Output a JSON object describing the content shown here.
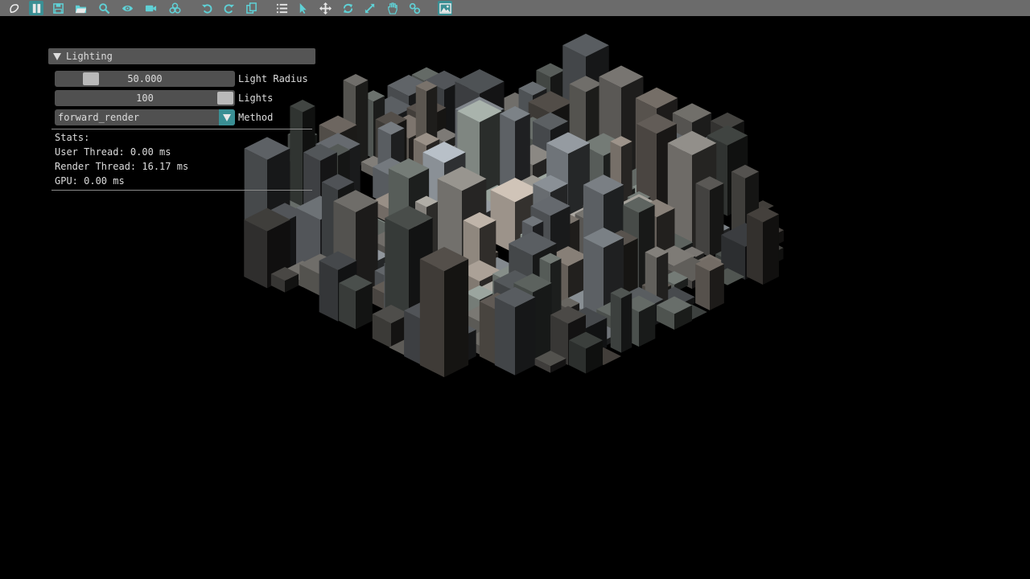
{
  "toolbar": {
    "buttons": [
      {
        "icon": "logo-icon"
      },
      {
        "icon": "pause-icon"
      },
      {
        "icon": "save-icon"
      },
      {
        "icon": "open-folder-icon"
      },
      {
        "icon": "search-icon"
      },
      {
        "icon": "eye-icon"
      },
      {
        "icon": "camera-icon"
      },
      {
        "icon": "nodes-icon"
      },
      {
        "icon": "undo-icon"
      },
      {
        "icon": "redo-icon"
      },
      {
        "icon": "copy-icon"
      },
      {
        "icon": "list-icon"
      },
      {
        "icon": "pointer-icon"
      },
      {
        "icon": "move-icon"
      },
      {
        "icon": "rotate-icon"
      },
      {
        "icon": "scale-icon"
      },
      {
        "icon": "hand-icon"
      },
      {
        "icon": "link-icon"
      },
      {
        "icon": "image-icon"
      }
    ],
    "icon_color": "#5fd1d6"
  },
  "panel": {
    "title": "Lighting",
    "light_radius": {
      "value": "50.000",
      "label": "Light Radius",
      "fraction": 0.2
    },
    "lights": {
      "value": "100",
      "label": "Lights",
      "fraction": 1.0
    },
    "method": {
      "value": "forward_render",
      "label": "Method"
    },
    "stats": {
      "heading": "Stats:",
      "user_thread": "User Thread: 0.00 ms",
      "render_thread": "Render Thread: 16.17 ms",
      "gpu": "GPU: 0.00 ms"
    }
  },
  "colors": {
    "toolbar_bg": "#6b6b6b",
    "accent": "#3a8f94",
    "panel_header": "#555555",
    "background": "#000000"
  }
}
